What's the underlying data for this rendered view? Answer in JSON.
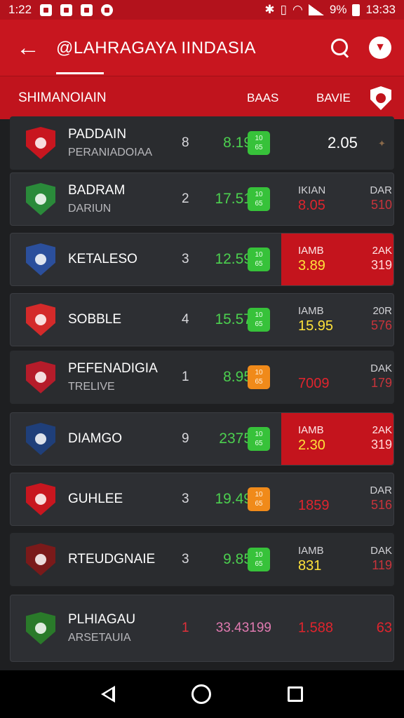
{
  "status_bar": {
    "time_left": "1:22",
    "battery": "9%",
    "time_right": "13:33"
  },
  "appbar": {
    "title": "@LAHRAGAYA IINDASIA"
  },
  "subheader": {
    "title": "SHIMANOIAIN",
    "col1": "BAAS",
    "col2": "BAVIE"
  },
  "rows": [
    {
      "name": "PADDAIN",
      "sub": "PERANIADOIAA",
      "rank": "8",
      "score": "8.19",
      "badge_top": "10",
      "badge_bottom": "65",
      "badge_color": "green",
      "single": "2.05",
      "crest": "#c8161f"
    },
    {
      "name": "BADRAM",
      "sub": "DARIUN",
      "rank": "2",
      "score": "17.51",
      "badge_top": "10",
      "badge_bottom": "65",
      "badge_color": "green",
      "lbl1": "IKIAN",
      "lbl2": "DAR",
      "val1": "8.05",
      "val2": "510",
      "crest": "#2a8a3a"
    },
    {
      "name": "KETALESO",
      "sub": "",
      "rank": "3",
      "score": "12.59",
      "badge_top": "10",
      "badge_bottom": "65",
      "badge_color": "green",
      "lbl1": "IAMB",
      "lbl2": "2AK",
      "val1": "3.89",
      "val2": "319",
      "red_side": true,
      "crest": "#2b4f9c"
    },
    {
      "name": "SOBBLE",
      "sub": "",
      "rank": "4",
      "score": "15.57",
      "badge_top": "10",
      "badge_bottom": "65",
      "badge_color": "green",
      "lbl1": "IAMB",
      "lbl2": "20R",
      "val1": "15.95",
      "val2": "576",
      "val1_yellow": true,
      "crest": "#d42a2a"
    },
    {
      "name": "PEFENADIGIA",
      "sub": "TRELIVE",
      "rank": "1",
      "score": "8.95",
      "badge_top": "10",
      "badge_bottom": "65",
      "badge_color": "orange",
      "lbl1": "",
      "lbl2": "DAK",
      "val1": "7009",
      "val2": "179",
      "crest": "#b51c2a"
    },
    {
      "name": "DIAMGO",
      "sub": "",
      "rank": "9",
      "score": "2375",
      "badge_top": "10",
      "badge_bottom": "65",
      "badge_color": "green",
      "lbl1": "IAMB",
      "lbl2": "2AK",
      "val1": "2.30",
      "val2": "319",
      "red_side": true,
      "crest": "#1f3f7a"
    },
    {
      "name": "GUHLEE",
      "sub": "",
      "rank": "3",
      "score": "19.49",
      "badge_top": "10",
      "badge_bottom": "65",
      "badge_color": "orange",
      "lbl1": "",
      "lbl2": "DAR",
      "val1": "1859",
      "val2": "516",
      "crest": "#c8161f"
    },
    {
      "name": "RTEUDGNAIE",
      "sub": "",
      "rank": "3",
      "score": "9.85",
      "badge_top": "10",
      "badge_bottom": "65",
      "badge_color": "green",
      "lbl1": "IAMB",
      "lbl2": "DAK",
      "val1": "831",
      "val2": "119",
      "val1_yellow": true,
      "crest": "#7a1a1a"
    },
    {
      "name": "PLHIAGAU",
      "sub": "ARSETAUIA",
      "rank": "1",
      "score": "33.43199",
      "lbl1": "",
      "lbl2": "",
      "val1": "1.588",
      "val2": "63",
      "crest": "#2a7a2a"
    }
  ]
}
